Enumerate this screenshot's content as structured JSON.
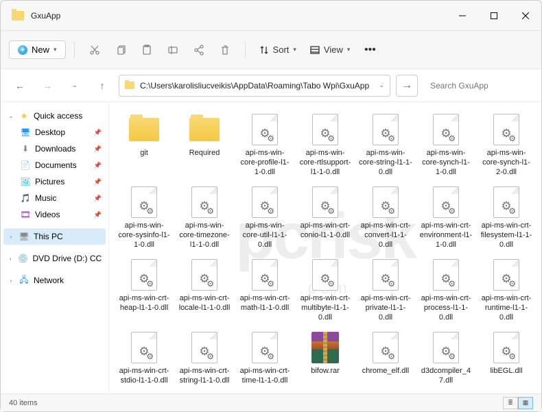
{
  "title": "GxuApp",
  "toolbar": {
    "new_label": "New",
    "sort_label": "Sort",
    "view_label": "View"
  },
  "address": {
    "path": "C:\\Users\\karolisliucveikis\\AppData\\Roaming\\Tabo Wpi\\GxuApp"
  },
  "search": {
    "placeholder": "Search GxuApp"
  },
  "sidebar": {
    "quick_access": "Quick access",
    "items": [
      {
        "label": "Desktop"
      },
      {
        "label": "Downloads"
      },
      {
        "label": "Documents"
      },
      {
        "label": "Pictures"
      },
      {
        "label": "Music"
      },
      {
        "label": "Videos"
      }
    ],
    "thispc": "This PC",
    "dvd": "DVD Drive (D:) CCCC",
    "network": "Network"
  },
  "files": [
    {
      "name": "git",
      "type": "folder"
    },
    {
      "name": "Required",
      "type": "folder"
    },
    {
      "name": "api-ms-win-core-profile-l1-1-0.dll",
      "type": "dll"
    },
    {
      "name": "api-ms-win-core-rtlsupport-l1-1-0.dll",
      "type": "dll"
    },
    {
      "name": "api-ms-win-core-string-l1-1-0.dll",
      "type": "dll"
    },
    {
      "name": "api-ms-win-core-synch-l1-1-0.dll",
      "type": "dll"
    },
    {
      "name": "api-ms-win-core-synch-l1-2-0.dll",
      "type": "dll"
    },
    {
      "name": "api-ms-win-core-sysinfo-l1-1-0.dll",
      "type": "dll"
    },
    {
      "name": "api-ms-win-core-timezone-l1-1-0.dll",
      "type": "dll"
    },
    {
      "name": "api-ms-win-core-util-l1-1-0.dll",
      "type": "dll"
    },
    {
      "name": "api-ms-win-crt-conio-l1-1-0.dll",
      "type": "dll"
    },
    {
      "name": "api-ms-win-crt-convert-l1-1-0.dll",
      "type": "dll"
    },
    {
      "name": "api-ms-win-crt-environment-l1-1-0.dll",
      "type": "dll"
    },
    {
      "name": "api-ms-win-crt-filesystem-l1-1-0.dll",
      "type": "dll"
    },
    {
      "name": "api-ms-win-crt-heap-l1-1-0.dll",
      "type": "dll"
    },
    {
      "name": "api-ms-win-crt-locale-l1-1-0.dll",
      "type": "dll"
    },
    {
      "name": "api-ms-win-crt-math-l1-1-0.dll",
      "type": "dll"
    },
    {
      "name": "api-ms-win-crt-multibyte-l1-1-0.dll",
      "type": "dll"
    },
    {
      "name": "api-ms-win-crt-private-l1-1-0.dll",
      "type": "dll"
    },
    {
      "name": "api-ms-win-crt-process-l1-1-0.dll",
      "type": "dll"
    },
    {
      "name": "api-ms-win-crt-runtime-l1-1-0.dll",
      "type": "dll"
    },
    {
      "name": "api-ms-win-crt-stdio-l1-1-0.dll",
      "type": "dll"
    },
    {
      "name": "api-ms-win-crt-string-l1-1-0.dll",
      "type": "dll"
    },
    {
      "name": "api-ms-win-crt-time-l1-1-0.dll",
      "type": "dll"
    },
    {
      "name": "bifow.rar",
      "type": "rar"
    },
    {
      "name": "chrome_elf.dll",
      "type": "dll"
    },
    {
      "name": "d3dcompiler_47.dll",
      "type": "dll"
    },
    {
      "name": "libEGL.dll",
      "type": "dll"
    }
  ],
  "status": {
    "count": "40 items"
  },
  "watermark": {
    "big": "pcrisk",
    "small": ".com"
  }
}
